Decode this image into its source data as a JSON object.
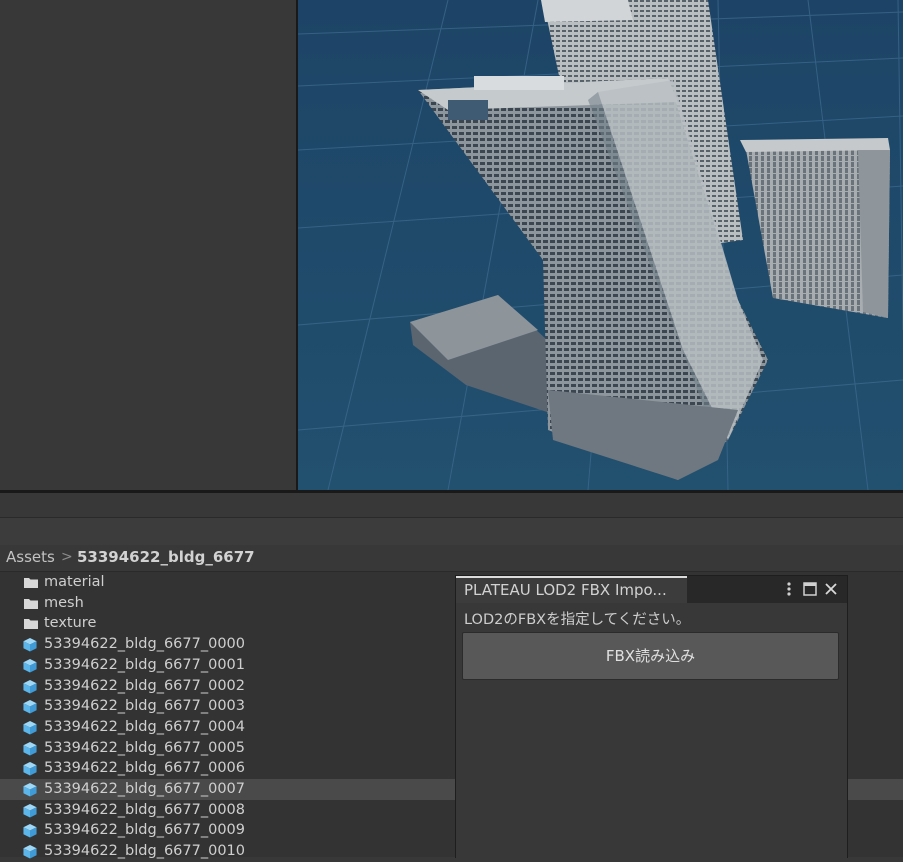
{
  "breadcrumb": {
    "root": "Assets",
    "separator": ">",
    "current": "53394622_bldg_6677"
  },
  "project_items": [
    {
      "type": "folder",
      "label": "material"
    },
    {
      "type": "folder",
      "label": "mesh"
    },
    {
      "type": "folder",
      "label": "texture"
    },
    {
      "type": "mesh",
      "label": "53394622_bldg_6677_0000"
    },
    {
      "type": "mesh",
      "label": "53394622_bldg_6677_0001"
    },
    {
      "type": "mesh",
      "label": "53394622_bldg_6677_0002"
    },
    {
      "type": "mesh",
      "label": "53394622_bldg_6677_0003"
    },
    {
      "type": "mesh",
      "label": "53394622_bldg_6677_0004"
    },
    {
      "type": "mesh",
      "label": "53394622_bldg_6677_0005"
    },
    {
      "type": "mesh",
      "label": "53394622_bldg_6677_0006"
    },
    {
      "type": "mesh",
      "label": "53394622_bldg_6677_0007",
      "selected": true
    },
    {
      "type": "mesh",
      "label": "53394622_bldg_6677_0008"
    },
    {
      "type": "mesh",
      "label": "53394622_bldg_6677_0009"
    },
    {
      "type": "mesh",
      "label": "53394622_bldg_6677_0010"
    }
  ],
  "importer_window": {
    "tab_title": "PLATEAU LOD2 FBX Impo...",
    "message": "LOD2のFBXを指定してください。",
    "import_button_label": "FBX読み込み",
    "icons": [
      "more-vert-icon",
      "maximize-icon",
      "close-icon"
    ]
  },
  "colors": {
    "scene_background": "#1f4a6d",
    "editor_background": "#383838",
    "mesh_icon": "#5db6ea",
    "selected_row": "#4a4a4a"
  }
}
